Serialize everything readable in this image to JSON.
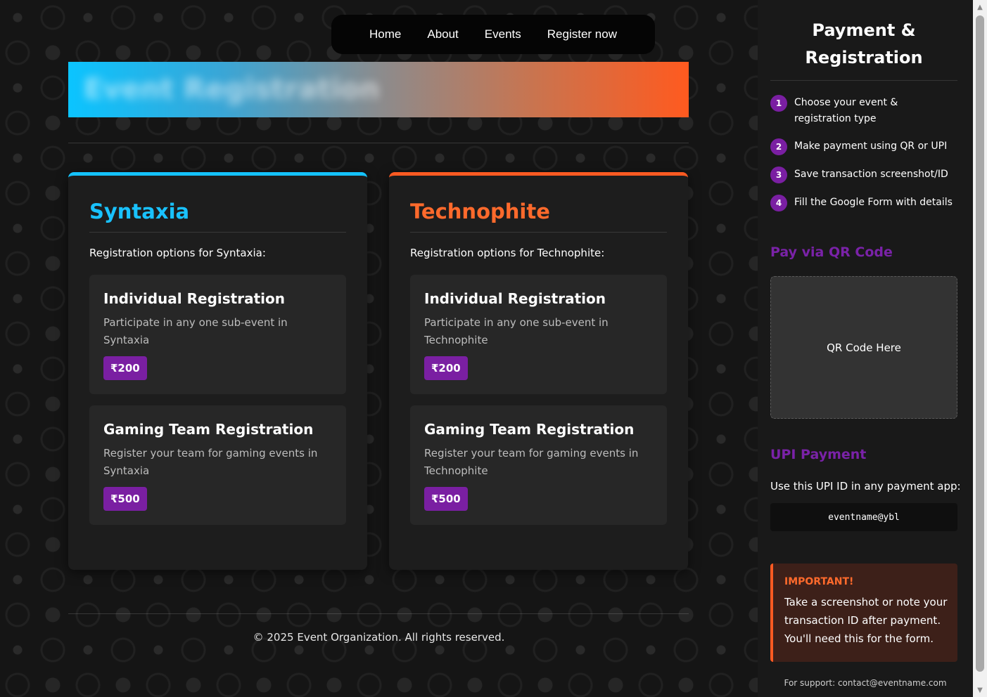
{
  "nav": {
    "items": [
      "Home",
      "About",
      "Events",
      "Register now"
    ]
  },
  "banner": {
    "title": "Event Registration"
  },
  "events": [
    {
      "name": "Syntaxia",
      "intro": "Registration options for Syntaxia:",
      "options": [
        {
          "title": "Individual Registration",
          "desc": "Participate in any one sub-event in Syntaxia",
          "price": "₹200"
        },
        {
          "title": "Gaming Team Registration",
          "desc": "Register your team for gaming events in Syntaxia",
          "price": "₹500"
        }
      ]
    },
    {
      "name": "Technophite",
      "intro": "Registration options for Technophite:",
      "options": [
        {
          "title": "Individual Registration",
          "desc": "Participate in any one sub-event in Technophite",
          "price": "₹200"
        },
        {
          "title": "Gaming Team Registration",
          "desc": "Register your team for gaming events in Technophite",
          "price": "₹500"
        }
      ]
    }
  ],
  "footer": {
    "copyright": "© 2025 Event Organization. All rights reserved."
  },
  "sidebar": {
    "title": "Payment & Registration",
    "steps": [
      {
        "num": "1",
        "text": "Choose your event & registration type"
      },
      {
        "num": "2",
        "text": "Make payment using QR or UPI"
      },
      {
        "num": "3",
        "text": "Save transaction screenshot/ID"
      },
      {
        "num": "4",
        "text": "Fill the Google Form with details"
      }
    ],
    "qr_heading": "Pay via QR Code",
    "qr_placeholder": "QR Code Here",
    "upi_heading": "UPI Payment",
    "upi_intro": "Use this UPI ID in any payment app:",
    "upi_id": "eventname@ybl",
    "important_title": "IMPORTANT!",
    "important_text": "Take a screenshot or note your transaction ID after payment. You'll need this for the form.",
    "support": "For support: contact@eventname.com"
  },
  "colors": {
    "syntaxia_accent": "#19c2ff",
    "technophite_accent": "#ff6a2c",
    "price_badge": "#7a1fa2",
    "sidebar_heading": "#7a22a8"
  }
}
